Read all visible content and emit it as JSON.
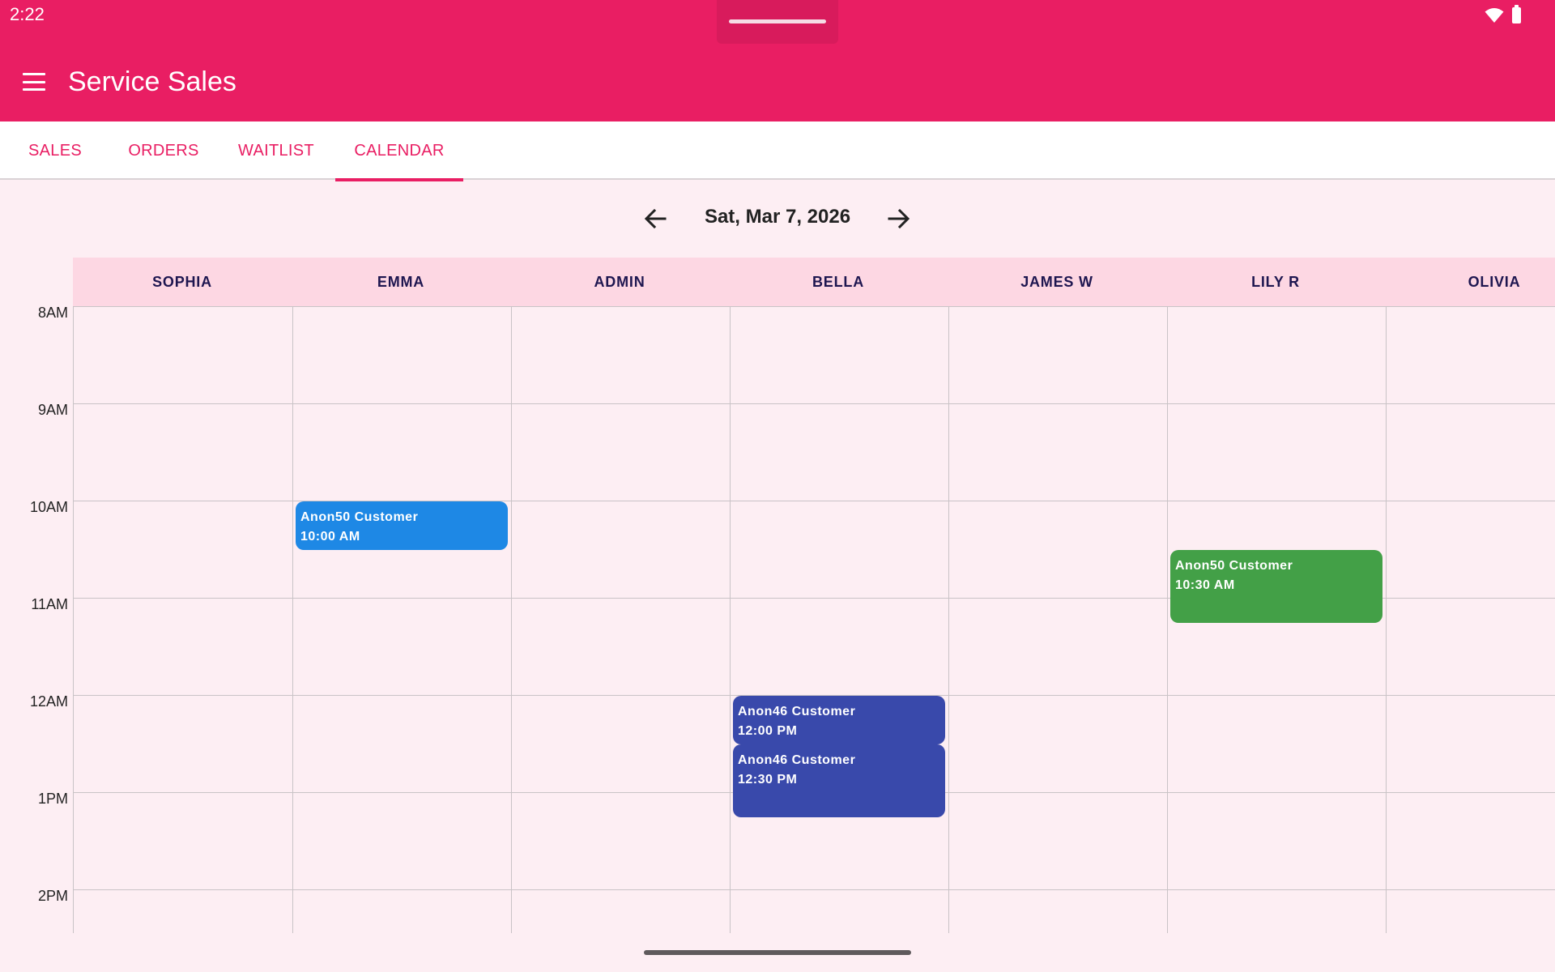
{
  "status": {
    "time": "2:22"
  },
  "app": {
    "title": "Service Sales"
  },
  "tabs": [
    {
      "label": "SALES",
      "active": false
    },
    {
      "label": "ORDERS",
      "active": false
    },
    {
      "label": "WAITLIST",
      "active": false
    },
    {
      "label": "CALENDAR",
      "active": true
    }
  ],
  "calendar": {
    "date": "Sat, Mar 7, 2026",
    "staff": [
      "SOPHIA",
      "EMMA",
      "ADMIN",
      "BELLA",
      "JAMES W",
      "LILY R",
      "OLIVIA"
    ],
    "hours": [
      "8AM",
      "9AM",
      "10AM",
      "11AM",
      "12AM",
      "1PM",
      "2PM"
    ],
    "appointments": [
      {
        "customer": "Anon50 Customer",
        "time": "10:00 AM",
        "staff": "EMMA",
        "color": "#1e88e5"
      },
      {
        "customer": "Anon50 Customer",
        "time": "10:30 AM",
        "staff": "LILY R",
        "color": "#43a047"
      },
      {
        "customer": "Anon46 Customer",
        "time": "12:00 PM",
        "staff": "BELLA",
        "color": "#3949ab"
      },
      {
        "customer": "Anon46 Customer",
        "time": "12:30 PM",
        "staff": "BELLA",
        "color": "#3949ab"
      }
    ]
  },
  "colors": {
    "primary": "#e91e63",
    "background": "#fdeef3",
    "header_row": "#fdd7e3"
  }
}
